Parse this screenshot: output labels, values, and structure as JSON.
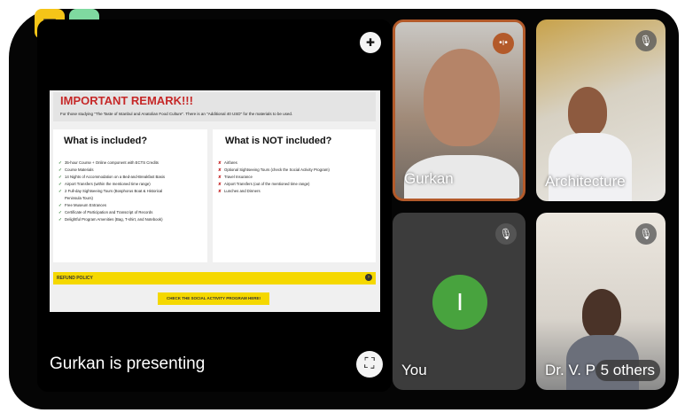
{
  "colors": {
    "remark_title": "#c62828",
    "included_check": "#2e7d32",
    "excluded_cross": "#c62828",
    "yellow_bar": "#f5d800",
    "speaker_ring": "#b35a2a",
    "you_avatar": "#48a33e"
  },
  "top_icons": [
    {
      "icon": "layout-off-icon",
      "glyph": "▦"
    },
    {
      "icon": "devices-icon",
      "glyph": "▭"
    }
  ],
  "presentation": {
    "pin_icon": "pin-icon",
    "pin_glyph": "✚",
    "presenting_label": "Gurkan is presenting",
    "fullscreen_icon": "fullscreen-icon",
    "fullscreen_glyph": "⛶",
    "slide": {
      "remark_title": "IMPORTANT REMARK!!!",
      "remark_text": "For those studying \"The Taste of Istanbul and Anatolian Food Culture\". There is an \"Additional 40 USD\" for the materials to be used.",
      "included_title": "What is included?",
      "included_items": [
        "35-hour Course + Online component with ECTS Credits",
        "Course Materials",
        "14 Nights of Accommodation on a Bed-and-Breakfast Basis",
        "Airport Transfers (within the mentioned time range)",
        "2 Full-day Sightseeing Tours (Bosphorus Boat & Historical",
        "Peninsula Tours)",
        "Free Museum Entrances",
        "Certificate of Participation and Transcript of Records",
        "Delightful Program Amenities (Bag, T-shirt, and Notebook)"
      ],
      "excluded_title": "What is NOT included?",
      "excluded_items": [
        "Airfares",
        "Optional Sightseeing Tours (check the Social Activity Program)",
        "Travel Insurance",
        "Airport Transfers (out of the mentioned time range)",
        "Lunches and Dinners"
      ],
      "check_mark": "✓",
      "cross_mark": "✘",
      "refund_label": "REFUND POLICY",
      "refund_chevron": "›",
      "social_button": "CHECK THE SOCIAL ACTIVITY PROGRAM HERE!"
    }
  },
  "participants": {
    "gurkan": {
      "name": "Gurkan",
      "status_icon": "speaking-icon",
      "status_glyph": "•ı•"
    },
    "architecture": {
      "name": "Architecture",
      "status_icon": "mic-off-icon",
      "status_glyph": "🎙"
    },
    "you": {
      "name": "You",
      "avatar_letter": "I",
      "status_icon": "mic-off-icon",
      "status_glyph": "🎙"
    },
    "dr": {
      "name": "Dr. V. P",
      "others_label": "5 others",
      "status_icon": "mic-off-icon",
      "status_glyph": "🎙"
    }
  }
}
